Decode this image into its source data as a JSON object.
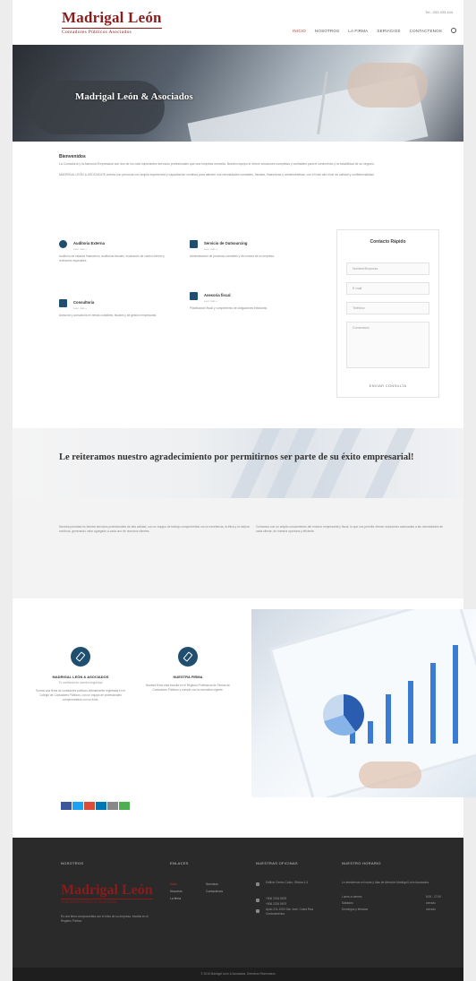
{
  "header": {
    "logo_name": "Madrigal León",
    "logo_sub": "Contadores Públicos Asociados",
    "phone": "Tel.: 033 333 444",
    "nav": [
      {
        "label": "Inicio",
        "active": true
      },
      {
        "label": "Nosotros"
      },
      {
        "label": "La firma"
      },
      {
        "label": "Servicios"
      },
      {
        "label": "Contactenos"
      }
    ]
  },
  "hero": {
    "title": "Madrigal León & Asociados"
  },
  "intro": {
    "title": "Bienvenidos",
    "p1": "La Contaduría y la Asesoría Empresarial son dos de los más importantes servicios profesionales que una empresa necesita. Nuestro equipo le ofrece soluciones completas y confiables para el crecimiento y la estabilidad de su negocio.",
    "p2": "MADRIGAL LEÓN & ASOCIADOS cuenta con personal con amplia experiencia y capacitación continua para atender sus necesidades contables, fiscales, financieras y administrativas, con el más alto nivel de calidad y confidencialidad."
  },
  "services": [
    {
      "title": "Auditoria Externa",
      "sub": "Leer más »",
      "desc": "Auditoría de estados financieros, auditorías fiscales, evaluación de control interno y revisiones especiales."
    },
    {
      "title": "Servicio de Outsourcing",
      "sub": "Leer más »",
      "desc": "Administración de procesos contables y de nómina de su empresa."
    },
    {
      "title": "Consultoria",
      "sub": "Leer más »",
      "desc": "Asesoría y consultoría en temas contables, fiscales y de gestión empresarial."
    },
    {
      "title": "Asesoria fiscal",
      "sub": "Leer más »",
      "desc": "Planificación fiscal y cumplimiento de obligaciones tributarias."
    }
  ],
  "contact_form": {
    "title": "Contacto Rápido",
    "name_placeholder": "Nombre/Empresa",
    "email_placeholder": "E-mail",
    "phone_placeholder": "Teléfono",
    "message_placeholder": "Comentario",
    "send_label": "Enviar consulta"
  },
  "banner": {
    "text": "Le reiteramos nuestro agradecimiento por permitirnos ser parte de su éxito empresarial!"
  },
  "gray_section": {
    "left": "Nuestra prioridad es brindar servicios profesionales de alta calidad, con un equipo de trabajo comprometido con la excelencia, la ética y la mejora continua, generando valor agregado a cada uno de nuestros clientes.",
    "right": "Contamos con un amplio conocimiento del entorno empresarial y fiscal, lo que nos permite ofrecer soluciones adecuadas a las necesidades de cada cliente, de manera oportuna y eficiente."
  },
  "features": [
    {
      "title": "Madrigal León & Asociados",
      "sub": "Tu confianza es nuestra seguridad",
      "desc": "Somos una firma de contadores públicos debidamente registrada en el Colegio de Contadores Públicos, con un equipo de profesionales comprometidos con su éxito."
    },
    {
      "title": "Nuestra firma",
      "sub": "",
      "desc": "Nuestra firma está inscrita en el Registro Profesional de Firmas de Contadores Públicos y cumple con la normativa vigente."
    }
  ],
  "social": [
    {
      "name": "facebook",
      "color": "#3b5998"
    },
    {
      "name": "twitter",
      "color": "#1da1f2"
    },
    {
      "name": "google-plus",
      "color": "#dd4b39"
    },
    {
      "name": "linkedin",
      "color": "#0077b5"
    },
    {
      "name": "email",
      "color": "#888888"
    },
    {
      "name": "whatsapp",
      "color": "#4caf50"
    }
  ],
  "footer": {
    "about_heading": "Nosotros",
    "about_logo_name": "Madrigal León",
    "about_logo_sub": "Contadores Públicos Asociados",
    "about_text": "Es una firma comprometida con el éxito de su empresa. Inscrita en el Registro Público.",
    "links_heading": "Enlaces",
    "links": [
      "Inicio",
      "Nosotros",
      "La firma",
      "Servicios",
      "Contactenos"
    ],
    "offices_heading": "Nuestras oficinas",
    "address": "Edificio Centro Colón, Oficina 1-3",
    "phone1": "+506 2234 5678",
    "phone2": "+506 2234 5679",
    "address2": "Apdo 211-1000 San José, Costa Rica Centroamérica",
    "hours_heading": "Nuestro horario",
    "hours_intro": "Le atendemos en horas y días de Atención Madrigal León Asociados.",
    "hours": [
      {
        "day": "Lunes a viernes",
        "time": "8:00 - 17:00"
      },
      {
        "day": "Sábados",
        "time": "cerrado"
      },
      {
        "day": "Domingos y feriados",
        "time": "cerrado"
      }
    ],
    "copyright": "© 2015 Madrigal León & Asociados. Derechos Reservados"
  }
}
